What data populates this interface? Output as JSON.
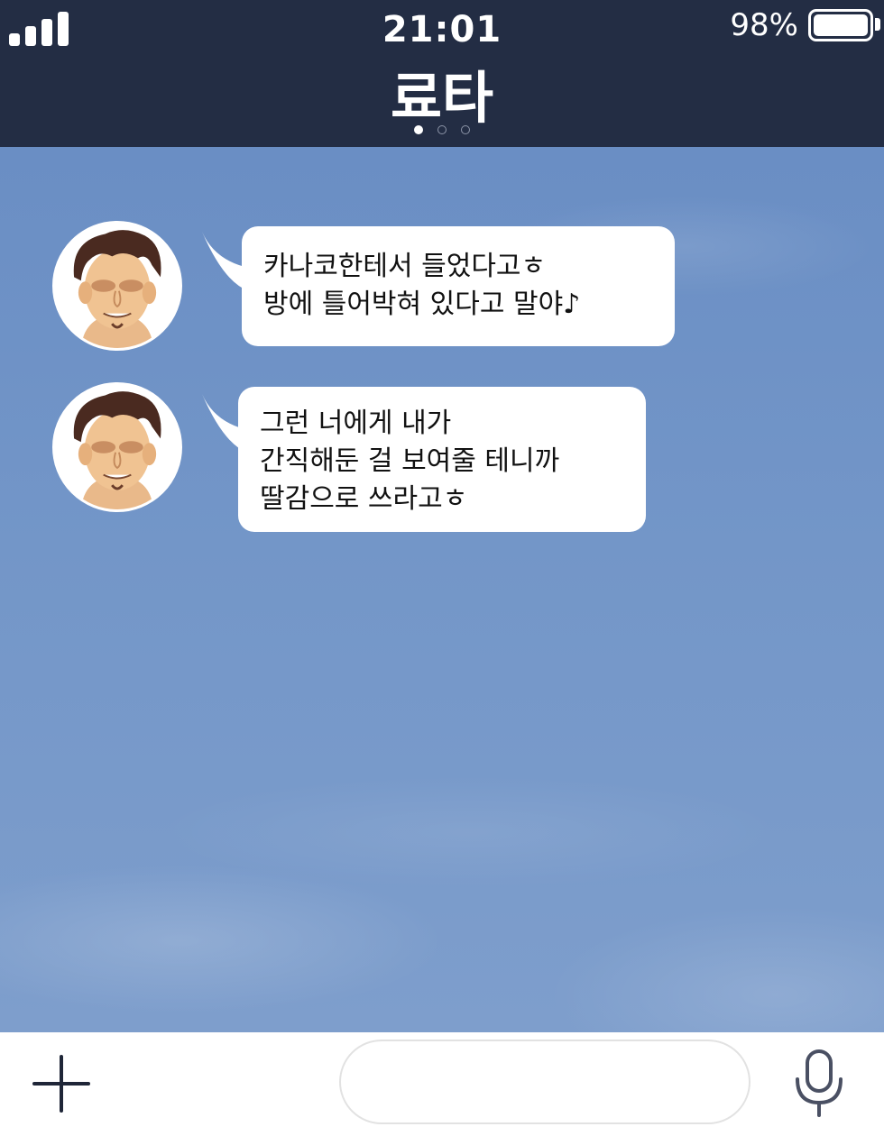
{
  "status_bar": {
    "time": "21:01",
    "battery": "98%"
  },
  "header": {
    "title": "료타",
    "page_indicator": {
      "count": 3,
      "active": 1
    }
  },
  "messages": [
    {
      "sender": "료타",
      "lines": [
        "카나코한테서 들었다고ㅎ",
        "방에 틀어박혀 있다고 말야♪"
      ]
    },
    {
      "sender": "료타",
      "lines": [
        "그런 너에게 내가",
        "간직해둔 걸 보여줄 테니까",
        "딸감으로 쓰라고ㅎ"
      ]
    }
  ],
  "input_bar": {
    "left_icon": "plus-icon",
    "right_icon": "microphone-icon",
    "field_value": ""
  },
  "colors": {
    "header_bg": "#232d44",
    "chat_bg": "#7396c8",
    "bubble_bg": "#ffffff"
  }
}
